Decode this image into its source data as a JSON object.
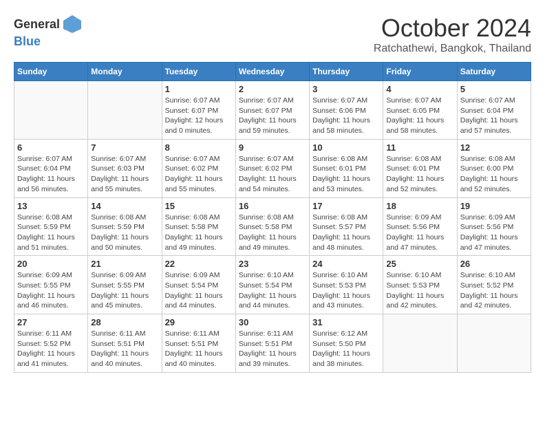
{
  "header": {
    "logo_general": "General",
    "logo_blue": "Blue",
    "month": "October 2024",
    "location": "Ratchathewi, Bangkok, Thailand"
  },
  "days_of_week": [
    "Sunday",
    "Monday",
    "Tuesday",
    "Wednesday",
    "Thursday",
    "Friday",
    "Saturday"
  ],
  "weeks": [
    [
      {
        "day": "",
        "info": ""
      },
      {
        "day": "",
        "info": ""
      },
      {
        "day": "1",
        "info": "Sunrise: 6:07 AM\nSunset: 6:07 PM\nDaylight: 12 hours\nand 0 minutes."
      },
      {
        "day": "2",
        "info": "Sunrise: 6:07 AM\nSunset: 6:07 PM\nDaylight: 11 hours\nand 59 minutes."
      },
      {
        "day": "3",
        "info": "Sunrise: 6:07 AM\nSunset: 6:06 PM\nDaylight: 11 hours\nand 58 minutes."
      },
      {
        "day": "4",
        "info": "Sunrise: 6:07 AM\nSunset: 6:05 PM\nDaylight: 11 hours\nand 58 minutes."
      },
      {
        "day": "5",
        "info": "Sunrise: 6:07 AM\nSunset: 6:04 PM\nDaylight: 11 hours\nand 57 minutes."
      }
    ],
    [
      {
        "day": "6",
        "info": "Sunrise: 6:07 AM\nSunset: 6:04 PM\nDaylight: 11 hours\nand 56 minutes."
      },
      {
        "day": "7",
        "info": "Sunrise: 6:07 AM\nSunset: 6:03 PM\nDaylight: 11 hours\nand 55 minutes."
      },
      {
        "day": "8",
        "info": "Sunrise: 6:07 AM\nSunset: 6:02 PM\nDaylight: 11 hours\nand 55 minutes."
      },
      {
        "day": "9",
        "info": "Sunrise: 6:07 AM\nSunset: 6:02 PM\nDaylight: 11 hours\nand 54 minutes."
      },
      {
        "day": "10",
        "info": "Sunrise: 6:08 AM\nSunset: 6:01 PM\nDaylight: 11 hours\nand 53 minutes."
      },
      {
        "day": "11",
        "info": "Sunrise: 6:08 AM\nSunset: 6:01 PM\nDaylight: 11 hours\nand 52 minutes."
      },
      {
        "day": "12",
        "info": "Sunrise: 6:08 AM\nSunset: 6:00 PM\nDaylight: 11 hours\nand 52 minutes."
      }
    ],
    [
      {
        "day": "13",
        "info": "Sunrise: 6:08 AM\nSunset: 5:59 PM\nDaylight: 11 hours\nand 51 minutes."
      },
      {
        "day": "14",
        "info": "Sunrise: 6:08 AM\nSunset: 5:59 PM\nDaylight: 11 hours\nand 50 minutes."
      },
      {
        "day": "15",
        "info": "Sunrise: 6:08 AM\nSunset: 5:58 PM\nDaylight: 11 hours\nand 49 minutes."
      },
      {
        "day": "16",
        "info": "Sunrise: 6:08 AM\nSunset: 5:58 PM\nDaylight: 11 hours\nand 49 minutes."
      },
      {
        "day": "17",
        "info": "Sunrise: 6:08 AM\nSunset: 5:57 PM\nDaylight: 11 hours\nand 48 minutes."
      },
      {
        "day": "18",
        "info": "Sunrise: 6:09 AM\nSunset: 5:56 PM\nDaylight: 11 hours\nand 47 minutes."
      },
      {
        "day": "19",
        "info": "Sunrise: 6:09 AM\nSunset: 5:56 PM\nDaylight: 11 hours\nand 47 minutes."
      }
    ],
    [
      {
        "day": "20",
        "info": "Sunrise: 6:09 AM\nSunset: 5:55 PM\nDaylight: 11 hours\nand 46 minutes."
      },
      {
        "day": "21",
        "info": "Sunrise: 6:09 AM\nSunset: 5:55 PM\nDaylight: 11 hours\nand 45 minutes."
      },
      {
        "day": "22",
        "info": "Sunrise: 6:09 AM\nSunset: 5:54 PM\nDaylight: 11 hours\nand 44 minutes."
      },
      {
        "day": "23",
        "info": "Sunrise: 6:10 AM\nSunset: 5:54 PM\nDaylight: 11 hours\nand 44 minutes."
      },
      {
        "day": "24",
        "info": "Sunrise: 6:10 AM\nSunset: 5:53 PM\nDaylight: 11 hours\nand 43 minutes."
      },
      {
        "day": "25",
        "info": "Sunrise: 6:10 AM\nSunset: 5:53 PM\nDaylight: 11 hours\nand 42 minutes."
      },
      {
        "day": "26",
        "info": "Sunrise: 6:10 AM\nSunset: 5:52 PM\nDaylight: 11 hours\nand 42 minutes."
      }
    ],
    [
      {
        "day": "27",
        "info": "Sunrise: 6:11 AM\nSunset: 5:52 PM\nDaylight: 11 hours\nand 41 minutes."
      },
      {
        "day": "28",
        "info": "Sunrise: 6:11 AM\nSunset: 5:51 PM\nDaylight: 11 hours\nand 40 minutes."
      },
      {
        "day": "29",
        "info": "Sunrise: 6:11 AM\nSunset: 5:51 PM\nDaylight: 11 hours\nand 40 minutes."
      },
      {
        "day": "30",
        "info": "Sunrise: 6:11 AM\nSunset: 5:51 PM\nDaylight: 11 hours\nand 39 minutes."
      },
      {
        "day": "31",
        "info": "Sunrise: 6:12 AM\nSunset: 5:50 PM\nDaylight: 11 hours\nand 38 minutes."
      },
      {
        "day": "",
        "info": ""
      },
      {
        "day": "",
        "info": ""
      }
    ]
  ]
}
